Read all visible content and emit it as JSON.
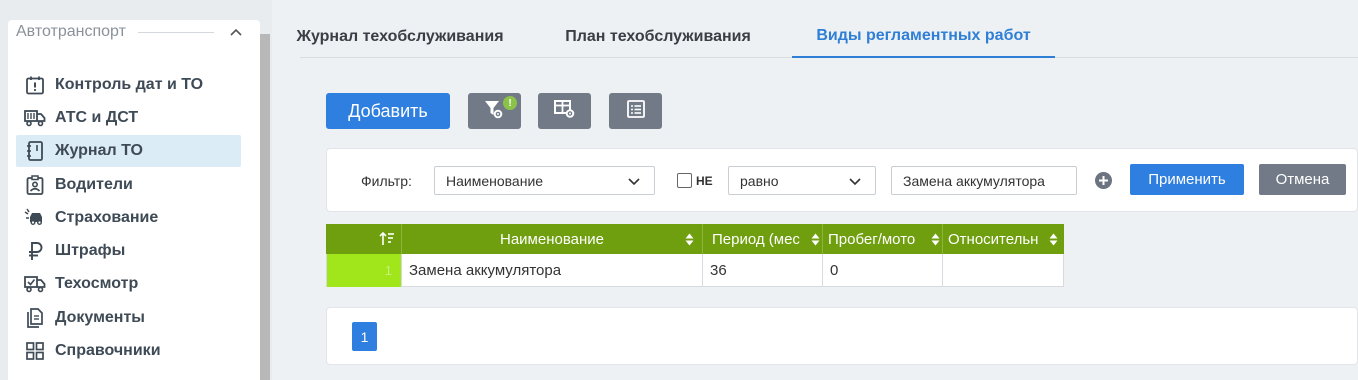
{
  "sidebar": {
    "section_title": "Автотранспорт",
    "items": [
      {
        "label": "Контроль дат и ТО",
        "icon": "calendar-alert-icon"
      },
      {
        "label": "АТС и ДСТ",
        "icon": "truck-icon"
      },
      {
        "label": "Журнал ТО",
        "icon": "journal-icon",
        "active": true
      },
      {
        "label": "Водители",
        "icon": "driver-badge-icon"
      },
      {
        "label": "Страхование",
        "icon": "car-crash-icon"
      },
      {
        "label": "Штрафы",
        "icon": "ruble-icon"
      },
      {
        "label": "Техосмотр",
        "icon": "truck-check-icon"
      },
      {
        "label": "Документы",
        "icon": "documents-icon"
      },
      {
        "label": "Справочники",
        "icon": "grid-icon"
      }
    ]
  },
  "tabs": [
    {
      "label": "Журнал техобслуживания"
    },
    {
      "label": "План техобслуживания"
    },
    {
      "label": "Виды регламентных работ",
      "active": true
    }
  ],
  "toolbar": {
    "add_label": "Добавить",
    "filter_badge": "!"
  },
  "filter": {
    "label": "Фильтр:",
    "field": "Наименование",
    "not_label": "НЕ",
    "not_checked": false,
    "operator": "равно",
    "value": "Замена аккумулятора",
    "apply_label": "Применить",
    "cancel_label": "Отмена"
  },
  "table": {
    "columns": [
      "Наименование",
      "Период (месяцы)",
      "Пробег/моточасы",
      "Относительно"
    ],
    "column_display": [
      "Наименование",
      "Период (мес",
      "Пробег/мото",
      "Относительн"
    ],
    "rows": [
      {
        "num": "1",
        "name": "Замена аккумулятора",
        "period": "36",
        "mileage": "0",
        "relative": ""
      }
    ]
  },
  "pager": {
    "current_page": "1"
  },
  "colors": {
    "accent": "#2f7fe0",
    "header_green": "#6f9e0e",
    "row_number_green": "#a1e51b",
    "secondary_button": "#717a86"
  }
}
